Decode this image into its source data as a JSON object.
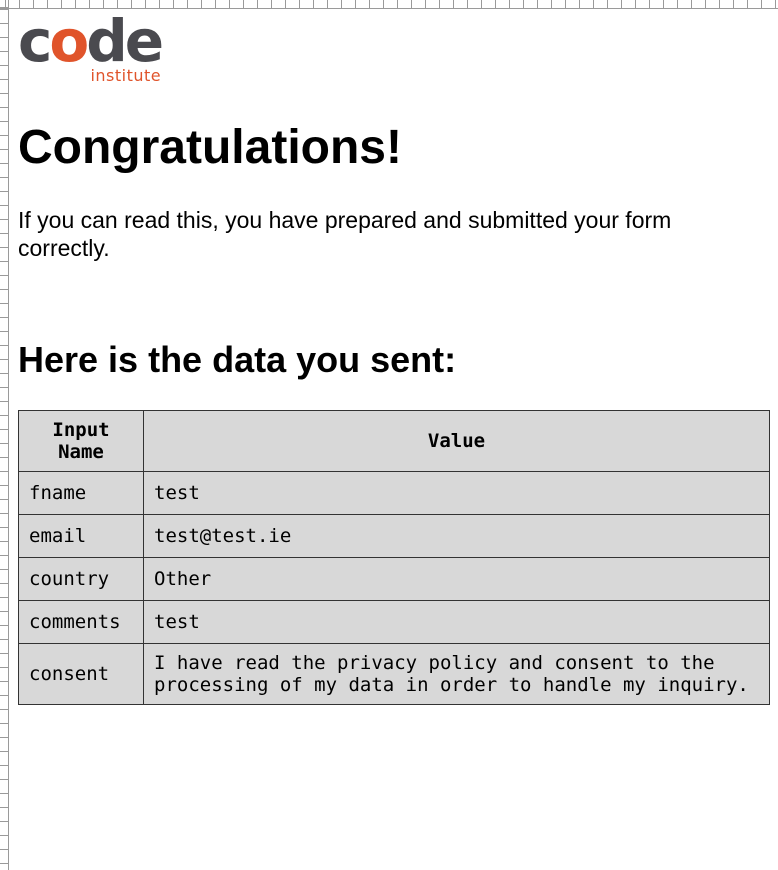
{
  "logo": {
    "word_prefix": "c",
    "word_o": "o",
    "word_suffix": "de",
    "subtitle": "institute",
    "colors": {
      "dark": "#4a4a4f",
      "accent": "#e0542b"
    }
  },
  "page": {
    "title": "Congratulations!",
    "lead": "If you can read this, you have prepared and submitted your form correctly.",
    "subtitle": "Here is the data you sent:"
  },
  "table": {
    "headers": [
      "Input Name",
      "Value"
    ],
    "rows": [
      {
        "name": "fname",
        "value": "test"
      },
      {
        "name": "email",
        "value": "test@test.ie"
      },
      {
        "name": "country",
        "value": "Other"
      },
      {
        "name": "comments",
        "value": "test"
      },
      {
        "name": "consent",
        "value": "I have read the privacy policy and consent to the processing of my data in order to handle my inquiry."
      }
    ]
  }
}
